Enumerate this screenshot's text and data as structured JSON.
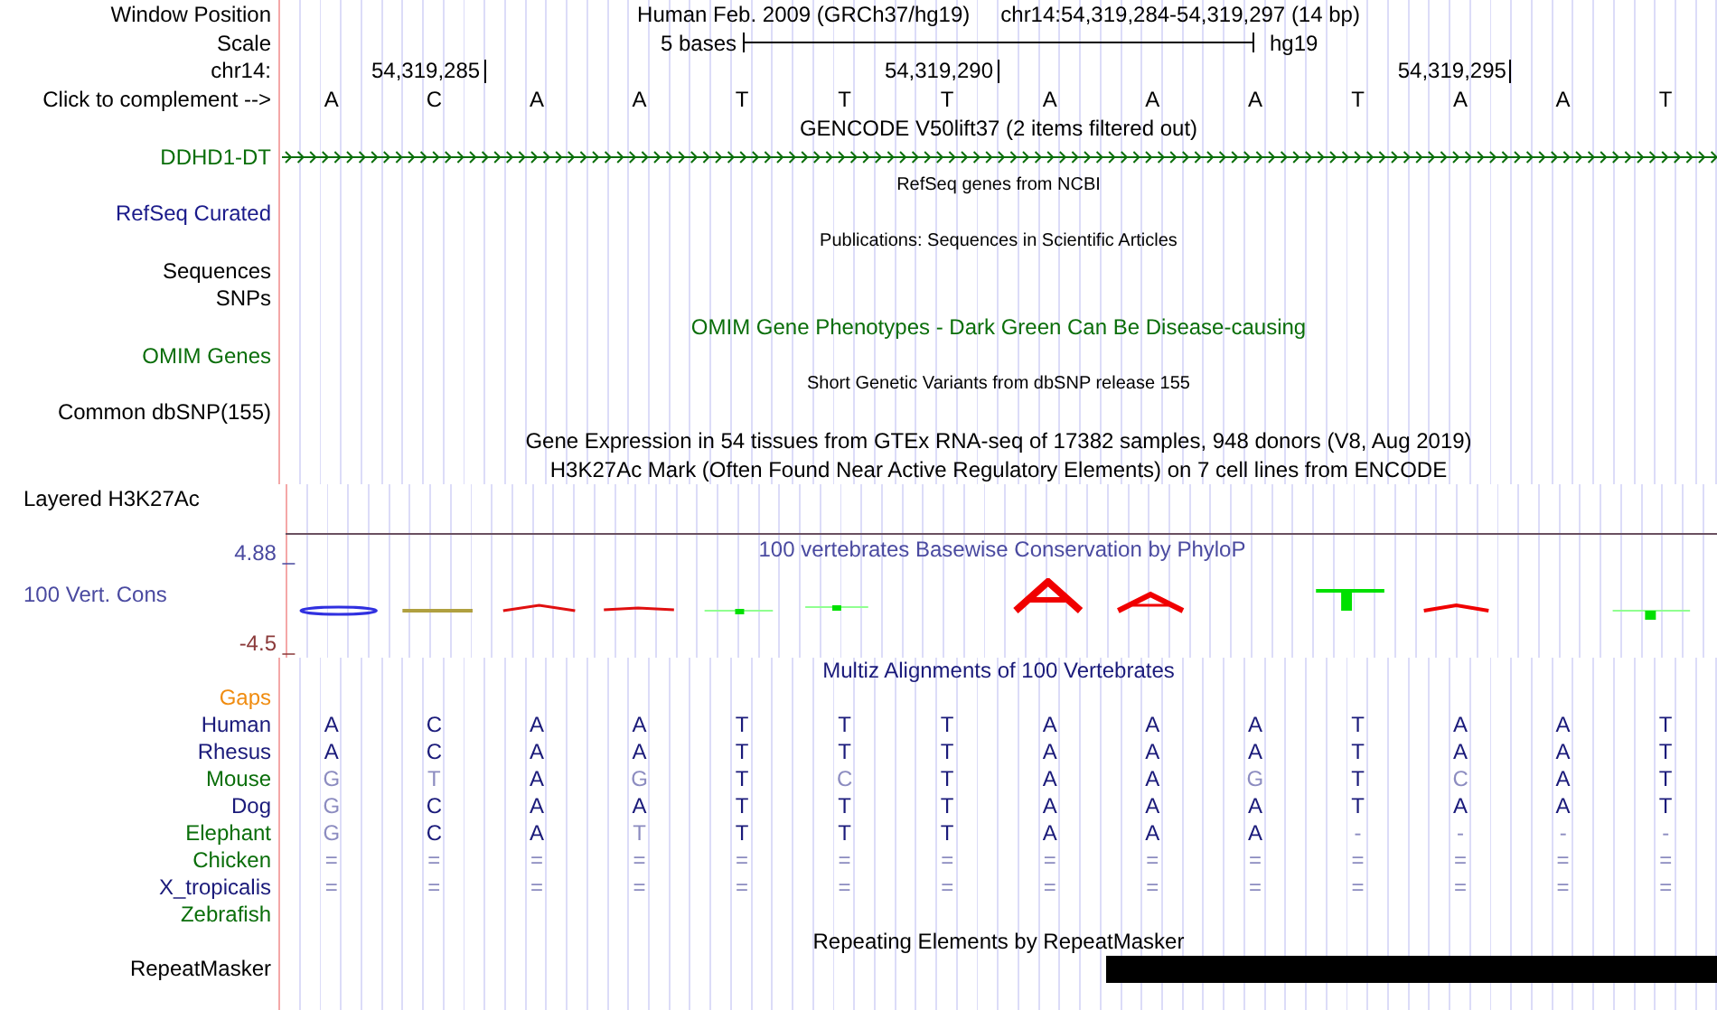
{
  "header": {
    "position_label": "Window Position",
    "assembly": "Human Feb. 2009 (GRCh37/hg19)",
    "position": "chr14:54,319,284-54,319,297 (14 bp)",
    "scale_label": "Scale",
    "scale_text": "5 bases",
    "scale_db": "hg19",
    "chrom_label": "chr14:",
    "ticks": [
      "54,319,285",
      "54,319,290",
      "54,319,295"
    ],
    "complement_label": "Click to complement -->",
    "bases": [
      "A",
      "C",
      "A",
      "A",
      "T",
      "T",
      "T",
      "A",
      "A",
      "A",
      "T",
      "A",
      "A",
      "T"
    ]
  },
  "tracks": [
    {
      "kind": "title",
      "text": "GENCODE V50lift37 (2 items filtered out)",
      "color": "#000000"
    },
    {
      "kind": "gene",
      "label": "DDHD1-DT",
      "color": "#0a6e0a"
    },
    {
      "kind": "small-title",
      "text": "RefSeq genes from NCBI"
    },
    {
      "kind": "label",
      "label": "RefSeq Curated",
      "color": "#1a1a8a"
    },
    {
      "kind": "small-title",
      "text": "Publications: Sequences in Scientific Articles"
    },
    {
      "kind": "label",
      "label": "Sequences",
      "color": "#000000"
    },
    {
      "kind": "label",
      "label": "SNPs",
      "color": "#000000"
    },
    {
      "kind": "title",
      "text": "OMIM Gene Phenotypes - Dark Green Can Be Disease-causing",
      "color": "#0a6e0a"
    },
    {
      "kind": "label",
      "label": "OMIM Genes",
      "color": "#0a6e0a"
    },
    {
      "kind": "small-title",
      "text": "Short Genetic Variants from dbSNP release 155"
    },
    {
      "kind": "label",
      "label": "Common dbSNP(155)",
      "color": "#000000"
    },
    {
      "kind": "title",
      "text": "Gene Expression in 54 tissues from GTEx RNA-seq of 17382 samples, 948 donors (V8, Aug 2019)",
      "color": "#000000"
    },
    {
      "kind": "title",
      "text": "H3K27Ac Mark (Often Found Near Active Regulatory Elements) on 7 cell lines from ENCODE",
      "color": "#000000"
    },
    {
      "kind": "side-label",
      "label": "Layered H3K27Ac",
      "color": "#000000"
    }
  ],
  "conservation": {
    "title": "100 vertebrates Basewise Conservation by PhyloP",
    "label": "100 Vert. Cons",
    "max": "4.88 _",
    "min": "-4.5 _"
  },
  "alignment": {
    "title": "Multiz Alignments of 100 Vertebrates",
    "rows": [
      {
        "kind": "gaps",
        "name": "Gaps",
        "color": "#f08c10"
      },
      {
        "kind": "species",
        "name": "Human",
        "color": "#1a1a7a",
        "bases": [
          {
            "base": "A",
            "match": true
          },
          {
            "base": "C",
            "match": true
          },
          {
            "base": "A",
            "match": true
          },
          {
            "base": "A",
            "match": true
          },
          {
            "base": "T",
            "match": true
          },
          {
            "base": "T",
            "match": true
          },
          {
            "base": "T",
            "match": true
          },
          {
            "base": "A",
            "match": true
          },
          {
            "base": "A",
            "match": true
          },
          {
            "base": "A",
            "match": true
          },
          {
            "base": "T",
            "match": true
          },
          {
            "base": "A",
            "match": true
          },
          {
            "base": "A",
            "match": true
          },
          {
            "base": "T",
            "match": true
          }
        ]
      },
      {
        "kind": "species",
        "name": "Rhesus",
        "color": "#1a1a7a",
        "bases": [
          {
            "base": "A",
            "match": true
          },
          {
            "base": "C",
            "match": true
          },
          {
            "base": "A",
            "match": true
          },
          {
            "base": "A",
            "match": true
          },
          {
            "base": "T",
            "match": true
          },
          {
            "base": "T",
            "match": true
          },
          {
            "base": "T",
            "match": true
          },
          {
            "base": "A",
            "match": true
          },
          {
            "base": "A",
            "match": true
          },
          {
            "base": "A",
            "match": true
          },
          {
            "base": "T",
            "match": true
          },
          {
            "base": "A",
            "match": true
          },
          {
            "base": "A",
            "match": true
          },
          {
            "base": "T",
            "match": true
          }
        ]
      },
      {
        "kind": "species",
        "name": "Mouse",
        "color": "#0a6e0a",
        "bases": [
          {
            "base": "G",
            "match": false
          },
          {
            "base": "T",
            "match": false
          },
          {
            "base": "A",
            "match": true
          },
          {
            "base": "G",
            "match": false
          },
          {
            "base": "T",
            "match": true
          },
          {
            "base": "C",
            "match": false
          },
          {
            "base": "T",
            "match": true
          },
          {
            "base": "A",
            "match": true
          },
          {
            "base": "A",
            "match": true
          },
          {
            "base": "G",
            "match": false
          },
          {
            "base": "T",
            "match": true
          },
          {
            "base": "C",
            "match": false
          },
          {
            "base": "A",
            "match": true
          },
          {
            "base": "T",
            "match": true
          }
        ]
      },
      {
        "kind": "species",
        "name": "Dog",
        "color": "#1a1a7a",
        "bases": [
          {
            "base": "G",
            "match": false
          },
          {
            "base": "C",
            "match": true
          },
          {
            "base": "A",
            "match": true
          },
          {
            "base": "A",
            "match": true
          },
          {
            "base": "T",
            "match": true
          },
          {
            "base": "T",
            "match": true
          },
          {
            "base": "T",
            "match": true
          },
          {
            "base": "A",
            "match": true
          },
          {
            "base": "A",
            "match": true
          },
          {
            "base": "A",
            "match": true
          },
          {
            "base": "T",
            "match": true
          },
          {
            "base": "A",
            "match": true
          },
          {
            "base": "A",
            "match": true
          },
          {
            "base": "T",
            "match": true
          }
        ]
      },
      {
        "kind": "species",
        "name": "Elephant",
        "color": "#0a6e0a",
        "bases": [
          {
            "base": "G",
            "match": false
          },
          {
            "base": "C",
            "match": true
          },
          {
            "base": "A",
            "match": true
          },
          {
            "base": "T",
            "match": false
          },
          {
            "base": "T",
            "match": true
          },
          {
            "base": "T",
            "match": true
          },
          {
            "base": "T",
            "match": true
          },
          {
            "base": "A",
            "match": true
          },
          {
            "base": "A",
            "match": true
          },
          {
            "base": "A",
            "match": true
          },
          {
            "base": "-",
            "match": false
          },
          {
            "base": "-",
            "match": false
          },
          {
            "base": "-",
            "match": false
          },
          {
            "base": "-",
            "match": false
          }
        ]
      },
      {
        "kind": "species",
        "name": "Chicken",
        "color": "#0a6e0a",
        "bases": [
          {
            "base": "=",
            "match": false
          },
          {
            "base": "=",
            "match": false
          },
          {
            "base": "=",
            "match": false
          },
          {
            "base": "=",
            "match": false
          },
          {
            "base": "=",
            "match": false
          },
          {
            "base": "=",
            "match": false
          },
          {
            "base": "=",
            "match": false
          },
          {
            "base": "=",
            "match": false
          },
          {
            "base": "=",
            "match": false
          },
          {
            "base": "=",
            "match": false
          },
          {
            "base": "=",
            "match": false
          },
          {
            "base": "=",
            "match": false
          },
          {
            "base": "=",
            "match": false
          },
          {
            "base": "=",
            "match": false
          }
        ]
      },
      {
        "kind": "species",
        "name": "X_tropicalis",
        "color": "#1a1a7a",
        "bases": [
          {
            "base": "=",
            "match": false
          },
          {
            "base": "=",
            "match": false
          },
          {
            "base": "=",
            "match": false
          },
          {
            "base": "=",
            "match": false
          },
          {
            "base": "=",
            "match": false
          },
          {
            "base": "=",
            "match": false
          },
          {
            "base": "=",
            "match": false
          },
          {
            "base": "=",
            "match": false
          },
          {
            "base": "=",
            "match": false
          },
          {
            "base": "=",
            "match": false
          },
          {
            "base": "=",
            "match": false
          },
          {
            "base": "=",
            "match": false
          },
          {
            "base": "=",
            "match": false
          },
          {
            "base": "=",
            "match": false
          }
        ]
      },
      {
        "kind": "species",
        "name": "Zebrafish",
        "color": "#0a6e0a"
      }
    ]
  },
  "repeats": {
    "title": "Repeating Elements by RepeatMasker",
    "label": "RepeatMasker"
  }
}
